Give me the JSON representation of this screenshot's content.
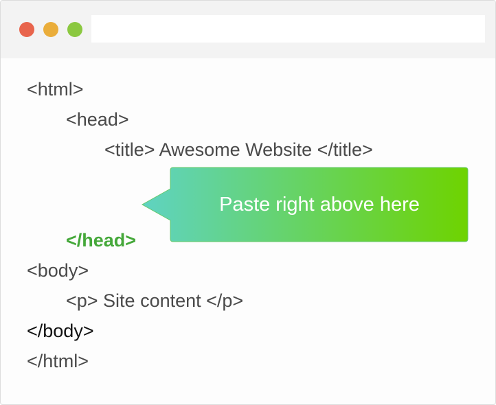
{
  "browser": {
    "window_controls": [
      "close",
      "minimize",
      "maximize"
    ],
    "address_bar": {
      "value": ""
    }
  },
  "code": {
    "lines": [
      "<html>",
      "<head>",
      "<title> Awesome Website </title>",
      "</head>",
      "<body>",
      "<p> Site content </p>",
      "</body>",
      "</html>"
    ]
  },
  "callout": {
    "text": "Paste right above here",
    "gradient_start": "#5fd3c2",
    "gradient_end": "#6ed300"
  },
  "colors": {
    "highlight": "#45a83a",
    "code_text": "#4a4a4a",
    "close": "#e8644c",
    "minimize": "#eaad3a",
    "maximize": "#8bc840"
  }
}
